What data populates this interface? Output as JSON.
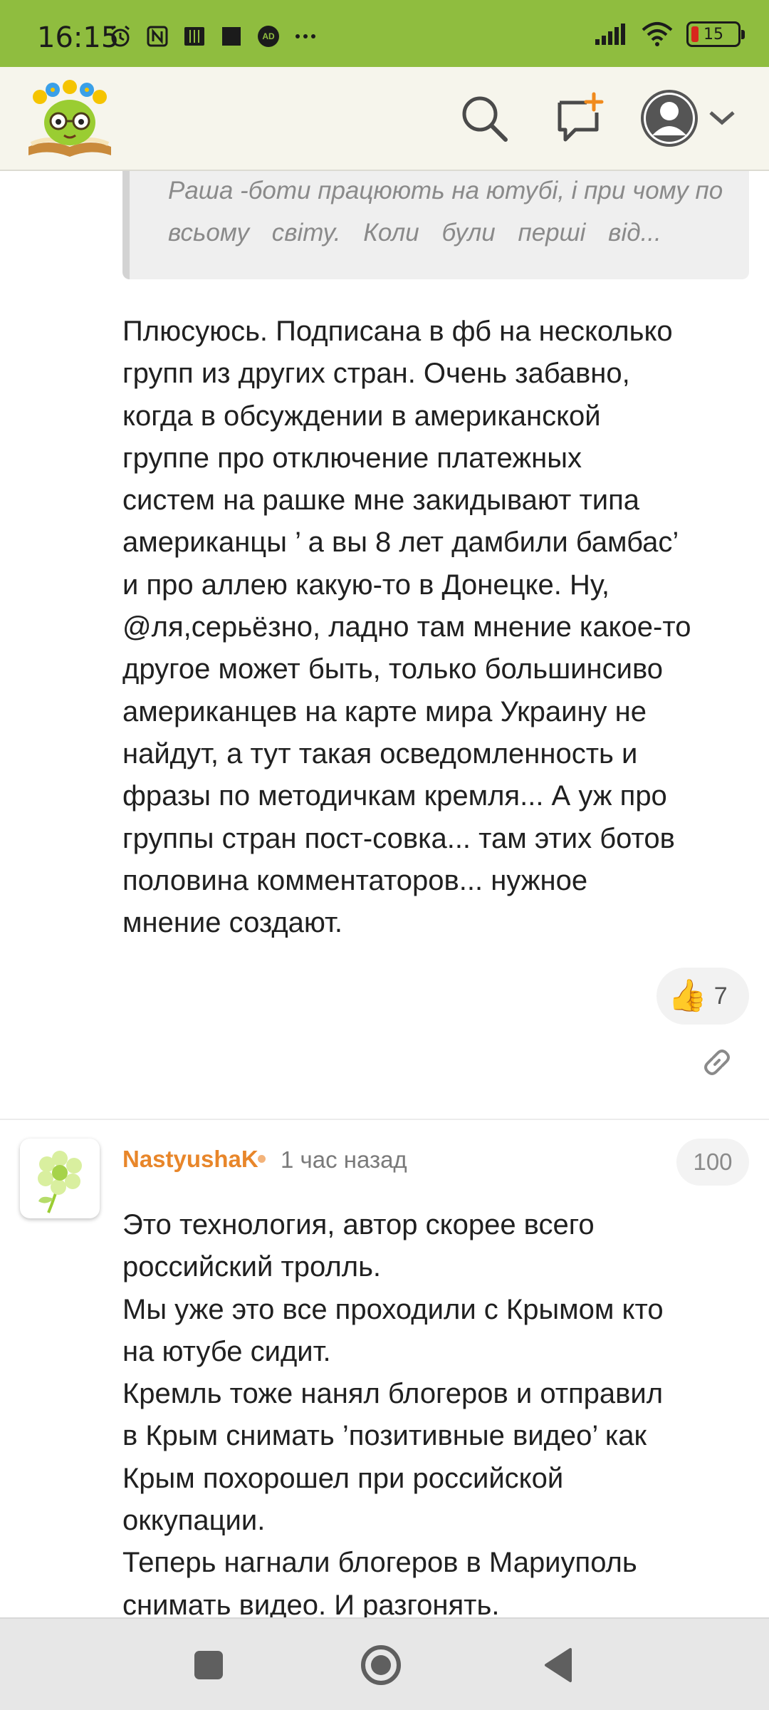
{
  "status_bar": {
    "time": "16:15",
    "battery_level": "15",
    "icons": [
      "alarm-icon",
      "nfc-icon",
      "app-icon",
      "app-icon",
      "adblock-icon",
      "more-icon",
      "signal-icon",
      "wifi-icon",
      "battery-icon"
    ],
    "adblock_label": "AD"
  },
  "header": {
    "logo": "site-logo",
    "icons": [
      "search-icon",
      "new-post-icon",
      "user-avatar-icon",
      "chevron-down-icon"
    ]
  },
  "quote": {
    "line1": "Раша -боти працюють на ютубі, і при чому по",
    "line2": "всьому світу. Коли були перші від..."
  },
  "comment1": {
    "lines": [
      "Плюсуюсь. Подписана в фб на несколько",
      "групп из других стран. Очень забавно,",
      "когда в обсуждении в американской",
      "группе про отключение платежных",
      "систем на рашке мне закидывают типа",
      "американцы ’ а вы 8 лет дамбили бамбас’",
      "и про аллею какую-то в Донецке. Ну,",
      "@ля,серьёзно, ладно там мнение какое-то",
      "другое может быть, только большинсиво",
      "американцев на карте мира Украину не",
      "найдут, а тут такая осведомленность и",
      "фразы по методичкам кремля... А уж про",
      "группы стран пост-совка... там этих ботов",
      "половина комментаторов... нужное",
      "мнение создают."
    ],
    "like_emoji": "👍",
    "like_count": "7"
  },
  "comment2": {
    "author": "NastyushaK",
    "time": "1 час назад",
    "rating": "100",
    "lines": [
      "Это технология, автор скорее всего",
      "российский тролль.",
      "Мы уже это все проходили с Крымом кто",
      "на ютубе сидит.",
      "Кремль тоже нанял блогеров и отправил",
      "в Крым снимать ’позитивные видео’ как",
      "Крым похорошел при российской",
      "оккупации.",
      "Теперь нагнали блогеров в Мариуполь",
      "снимать видео. И разгонять."
    ]
  },
  "colors": {
    "status_bar": "#8fbd3f",
    "header_bg": "#f6f5ec",
    "author": "#e8862a",
    "text": "#202020"
  },
  "nav": {
    "icons": [
      "recent-apps-icon",
      "home-icon",
      "back-icon"
    ]
  }
}
